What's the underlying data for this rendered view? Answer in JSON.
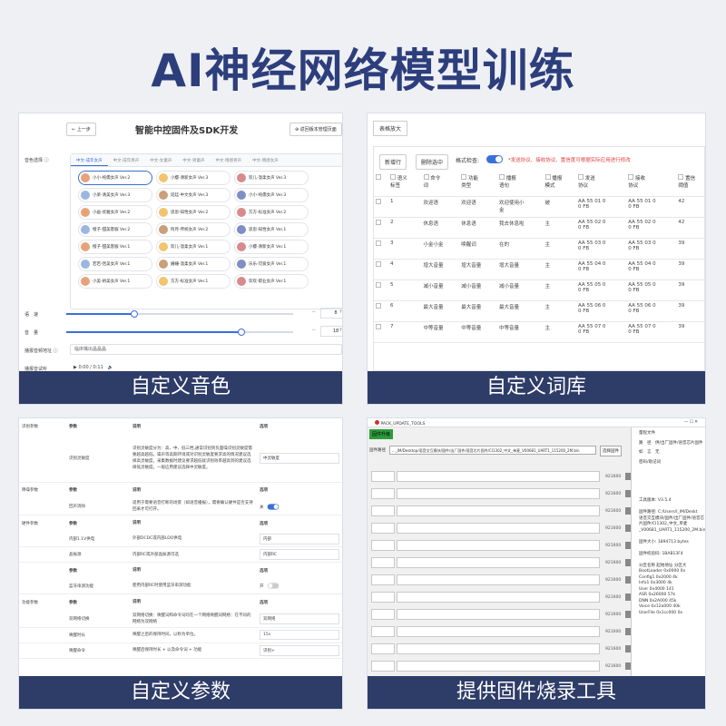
{
  "title": "AI神经网络模型训练",
  "captions": [
    "自定义音色",
    "自定义词库",
    "自定义参数",
    "提供固件烧录工具"
  ],
  "panel1": {
    "back": "← 上一步",
    "heading": "智能中控固件及SDK开发",
    "manage": "⊕ 返回版本管理页面",
    "voice_label": "音色选择 ⓘ",
    "tabs": [
      "中文-成年女声",
      "中文-成年男声",
      "中文-女童声",
      "中文-男童声",
      "中文-情感男声",
      "中文-情感女声"
    ],
    "voices": [
      "小小-纯儒女声 Ver.2",
      "小樱-清新女声 Ver.3",
      "欢儿-温柔女声 Ver.3",
      "小梁-清美女声 Ver.3",
      "延廷-中文女声 Ver.3",
      "小小-纯儒女声 Ver.3",
      "小画-优雅女声 Ver.2",
      "思思-知性女声 Ver.2",
      "方方-标准女声 Ver.2",
      "橙子-甜美客服 Ver.2",
      "阿月-传统女声 Ver.2",
      "思思-知性女声 Ver.1",
      "橙子-甜美客服 Ver.1",
      "欢儿-温柔女声 Ver.1",
      "小樱-清新女声 Ver.1",
      "若若-恬美女声 Ver.1",
      "姗姗-温柔女声 Ver.1",
      "乐乐-可爱女声 Ver.1",
      "小美-娇美女声 Ver.1",
      "方方-标准女声 Ver.1",
      "欢欢-职业女声 Ver.1"
    ],
    "speed_label": "语　速",
    "speed_value": "8",
    "speed_level": 0.3,
    "volume_label": "音　量",
    "volume_value": "18",
    "volume_level": 0.77,
    "wake_label": "播报音频地址 ⓘ",
    "wake_select": "临床嘴出晶晶晶",
    "trial_label": "播报音试听",
    "player_time": "0:00 / 0:11"
  },
  "panel2": {
    "zoom": "表格放大",
    "add_row": "新增行",
    "delete_selected": "删除选中",
    "format_check": "格式检查:",
    "format_toggle": "开",
    "warning": "*发送协议、接收协议、置信度可根据实际应用进行修改",
    "columns": [
      "",
      "语义\n标签",
      "命令\n词",
      "功能\n类型",
      "播报\n语句",
      "播报\n模式",
      "发送\n协议",
      "接收\n协议",
      "置信\n阈值"
    ],
    "rows": [
      [
        "1",
        "欢迎语",
        "欢迎语",
        "欢迎使用小\n金",
        "被",
        "AA 55 01 0\n0 FB",
        "AA 55 01 0\n0 FB",
        "42"
      ],
      [
        "2",
        "休息语",
        "休息语",
        "我去休息啦",
        "主",
        "AA 55 02 0\n0 FB",
        "AA 55 02 0\n0 FB",
        "42"
      ],
      [
        "3",
        "小金小金",
        "唤醒词",
        "在的",
        "主",
        "AA 55 03 0\n0 FB",
        "AA 55 03 0\n0 FB",
        "39"
      ],
      [
        "4",
        "增大音量",
        "增大音量",
        "增大音量",
        "主",
        "AA 55 04 0\n0 FB",
        "AA 55 04 0\n0 FB",
        "39"
      ],
      [
        "5",
        "减小音量",
        "减小音量",
        "减小音量",
        "主",
        "AA 55 05 0\n0 FB",
        "AA 55 05 0\n0 FB",
        "39"
      ],
      [
        "6",
        "最大音量",
        "最大音量",
        "最大音量",
        "主",
        "AA 55 06 0\n0 FB",
        "AA 55 06 0\n0 FB",
        "39"
      ],
      [
        "7",
        "中等音量",
        "中等音量",
        "中等音量",
        "主",
        "AA 55 07 0\n0 FB",
        "AA 55 07 0\n0 FB",
        "39"
      ]
    ]
  },
  "panel3": {
    "sections": [
      {
        "section": "识别参数",
        "param": "参数",
        "desc": "说明",
        "option": "选项",
        "header": true
      },
      {
        "section": "",
        "param": "识别灵敏度",
        "desc": "识别灵敏度分为：高、中、低三档,通常识别到负面噪识别灵敏度需要越高越低。噪声等高期环境或对识别灵敏度要求高的情况建议选择高灵敏度，采集数据时建议要求越低就识别效率越高到的建议选择低灵敏度。一般应用建议选择中灵敏度。",
        "option": "中灵敏度",
        "tall": true
      },
      {
        "section": "降噪参数",
        "param": "参数",
        "desc": "说明",
        "option": "选项",
        "header": true
      },
      {
        "section": "",
        "param": "回声消除",
        "desc": "适用于需要语音打断的场景（如语音播报），需要确认硬件是否支持回采才可打开。",
        "option": "关",
        "toggle": true
      },
      {
        "section": "硬件参数",
        "param": "参数",
        "desc": "说明",
        "option": "选项",
        "header": true
      },
      {
        "section": "",
        "param": "内部1.1V供电",
        "desc": "外部DCDC或内部LDO供电",
        "option": "内部"
      },
      {
        "section": "",
        "param": "晶振源",
        "desc": "内部RC或外部晶振源可选",
        "option": "内部RC"
      },
      {
        "section": "",
        "param": "参数",
        "desc": "说明",
        "option": "选项",
        "header": true
      },
      {
        "section": "",
        "param": "蓝牙串测功能",
        "desc": "使用内部RC时使用蓝牙串测功能",
        "option": "开",
        "toggle": true
      },
      {
        "section": "功能参数",
        "param": "参数",
        "desc": "说明",
        "option": "选项",
        "header": true
      },
      {
        "section": "",
        "param": "双网络切换",
        "desc": "双网络切换：唤醒词和命令词均在一个网络唤醒词网络：在不同的网络为双网络",
        "option": "双网络"
      },
      {
        "section": "",
        "param": "唤醒时长",
        "desc": "唤醒之后的保持时间，以秒为单位。",
        "option": "15s"
      },
      {
        "section": "",
        "param": "唤醒命令",
        "desc": "唤醒后保持时长 + 以及命令词 + 功能",
        "option": "识别+"
      }
    ]
  },
  "panel4": {
    "app_title": "PACK_UPDATE_TOOLS",
    "fw_btn": "固件升级",
    "fw_path_label": "固件路径",
    "fw_path": "..._IM/Desktop/语音交互模块/固件/出厂固件/语音芯片固件/CI1302_中文_单麦_V00681_UART1_115200_2M.bin",
    "fw_btn2": "选择固件",
    "baud": "921600",
    "rows": 14,
    "right_items": [
      "量程文件",
      "路　径　供/出厂固件/语音芯片固件",
      "如　言　无",
      "密码/助记词"
    ],
    "info": [
      "工具版本: V3.5.4",
      "",
      "固件路径: C:/Users/l_IM/Deskt",
      "语音交互模块/固件/出厂固件/语音芯",
      "片固件/CI1302_中文_单麦",
      "_V00681_UART1_115200_2M.bin",
      "",
      "固件大小: 1894713 bytes",
      "",
      "固件校验码: 1BAB13F4",
      "",
      "分区名称    起始地址    分区大",
      "BootLoader  0x0000     0x",
      "Config1     0x2000     4k",
      "Info1       0x3000     4k",
      "User        0x4000     141",
      "ASR         0x26000    57k",
      "DNN         0x2A000    45k",
      "Voice       0x12a000   40k",
      "UserFile    0x1cc000   0x"
    ]
  },
  "colors": {
    "title": "#2d3e7c",
    "caption_bg": "#2e3c68",
    "accent": "#3a6fd8",
    "warning": "#e04040"
  }
}
